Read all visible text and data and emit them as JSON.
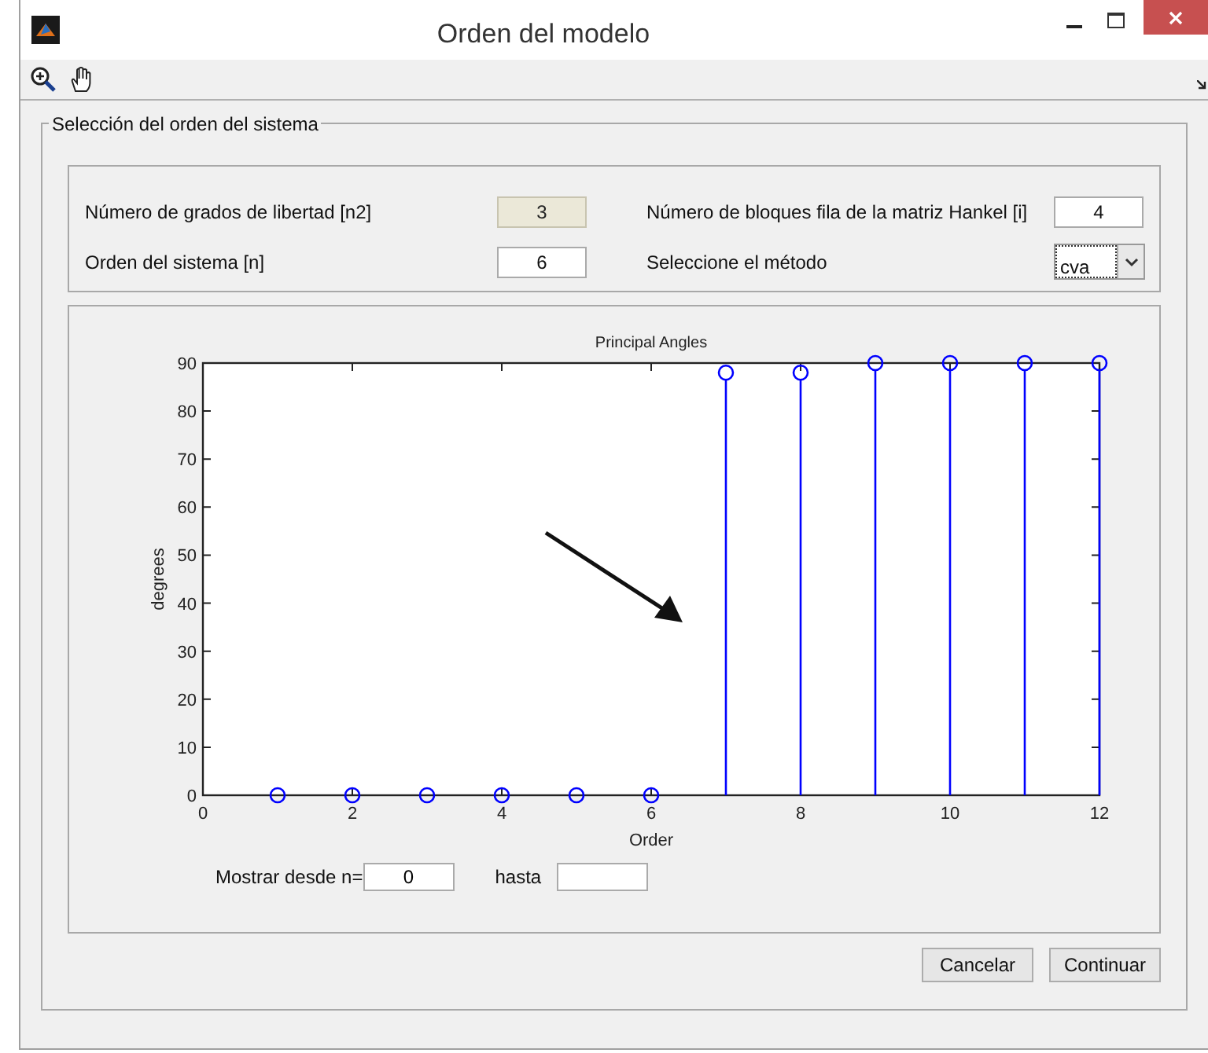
{
  "window": {
    "title": "Orden del modelo"
  },
  "group": {
    "legend": "Selección del orden del sistema"
  },
  "params": [
    {
      "kind": "field",
      "label": "Número de grados de libertad [n2]",
      "value": "3",
      "disabled": true
    },
    {
      "kind": "field",
      "label": "Número de bloques fila de la matriz Hankel [i]",
      "value": "4",
      "disabled": false
    },
    {
      "kind": "field",
      "label": "Orden del sistema [n]",
      "value": "6",
      "disabled": false
    },
    {
      "kind": "dropdown",
      "label": "Seleccione el método",
      "value": "cva",
      "disabled": false
    }
  ],
  "chart_data": {
    "type": "scatter",
    "title": "Principal Angles",
    "xlabel": "Order",
    "ylabel": "degrees",
    "x": [
      1,
      2,
      3,
      4,
      5,
      6,
      7,
      8,
      9,
      10,
      11,
      12
    ],
    "series": [
      {
        "color": "#0000ff",
        "values": [
          0,
          0,
          0,
          0,
          0,
          0,
          88,
          88,
          90,
          90,
          90,
          90
        ]
      }
    ],
    "xlim": [
      0,
      12
    ],
    "ylim": [
      0,
      90
    ],
    "xticks": [
      0,
      2,
      4,
      6,
      8,
      10,
      12
    ],
    "yticks": [
      0,
      10,
      20,
      30,
      40,
      50,
      60,
      70,
      80,
      90
    ]
  },
  "range": {
    "from_label": "Mostrar desde n=",
    "from_value": "0",
    "to_label": "hasta"
  },
  "buttons": [
    "Cancelar",
    "Continuar"
  ]
}
